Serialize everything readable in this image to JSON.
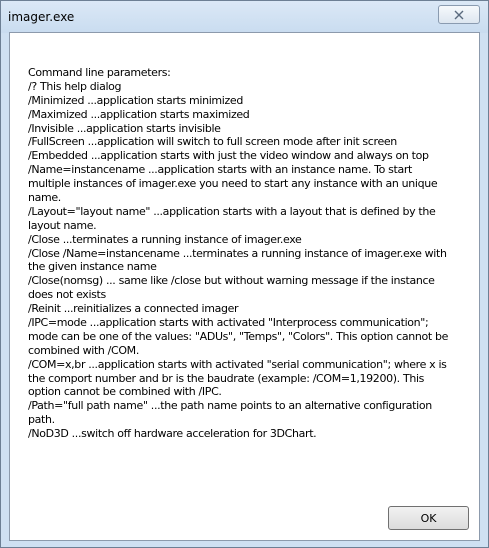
{
  "window": {
    "title": "imager.exe",
    "close_icon": "close-icon"
  },
  "help_text": [
    "Command line parameters:",
    "/?  This help dialog",
    "/Minimized  ...application starts minimized",
    "/Maximized  ...application starts maximized",
    "/Invisible  ...application starts invisible",
    "/FullScreen  ...application will switch to full screen mode after init screen",
    "/Embedded  ...application starts with just the video window and always on top",
    "/Name=instancename  ...application starts with an instance name. To start",
    "multiple instances of imager.exe you need to start any instance with an unique",
    "name.",
    "/Layout=\"layout name\"  ...application starts with a layout that is defined by the",
    "layout name.",
    "/Close ...terminates a running instance of imager.exe",
    "/Close /Name=instancename ...terminates a running instance of imager.exe with",
    "the given instance name",
    "/Close(nomsg) ... same like /close but without warning message if the instance",
    "does not exists",
    "/Reinit ...reinitializes a connected imager",
    "/IPC=mode ...application starts with activated \"Interprocess communication\";",
    "mode can be one of the values: \"ADUs\", \"Temps\", \"Colors\". This option cannot be",
    "combined with /COM.",
    "/COM=x,br ...application starts with activated \"serial communication\"; where x is",
    "the comport number and br is the baudrate (example: /COM=1,19200). This",
    "option cannot be combined with /IPC.",
    "/Path=\"full path name\" ...the path name points to an alternative configuration",
    "path.",
    "/NoD3D    ...switch off hardware acceleration for 3DChart."
  ],
  "buttons": {
    "ok_label": "OK"
  }
}
